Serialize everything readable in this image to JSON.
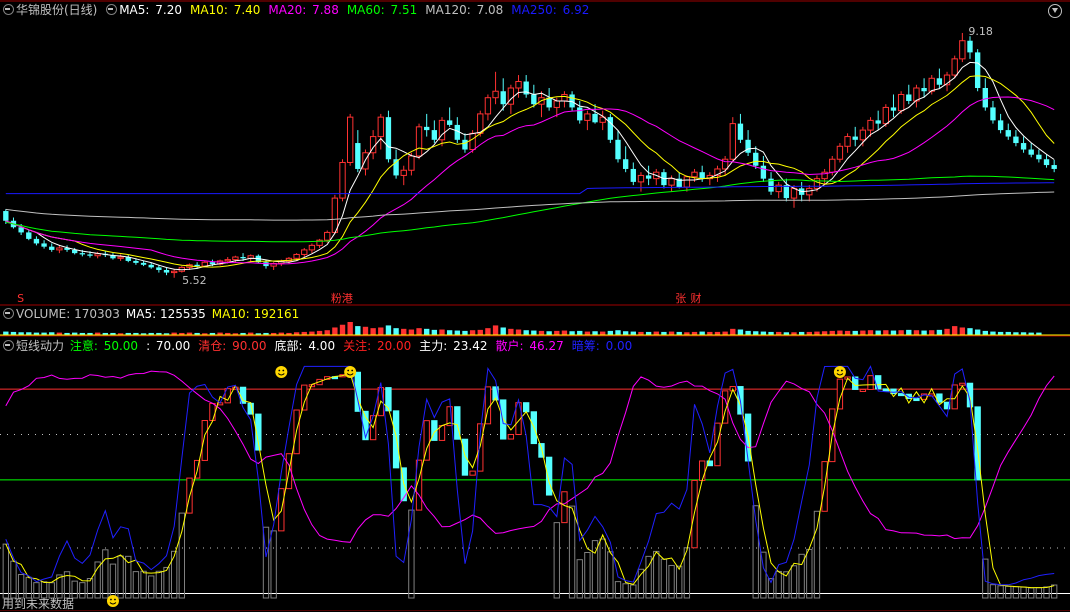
{
  "header": {
    "stock_name": "华锦股份(日线)",
    "ma": [
      {
        "label": "MA5: ",
        "value": "7.20",
        "color": "#ffffff"
      },
      {
        "label": "MA10: ",
        "value": "7.40",
        "color": "#ffff00"
      },
      {
        "label": "MA20: ",
        "value": "7.88",
        "color": "#ff00ff"
      },
      {
        "label": "MA60: ",
        "value": "7.51",
        "color": "#00ff00"
      },
      {
        "label": "MA120: ",
        "value": "7.08",
        "color": "#c0c0c0"
      },
      {
        "label": "MA250: ",
        "value": "6.92",
        "color": "#1a1aff"
      }
    ]
  },
  "volume_header": [
    {
      "text": "VOLUME: 170303",
      "color": "#c0c0c0"
    },
    {
      "text": "MA5: 125535",
      "color": "#ffffff"
    },
    {
      "text": "MA10: 192161",
      "color": "#ffff00"
    }
  ],
  "indicator_header": {
    "name": "短线动力",
    "items": [
      {
        "label": "注意: ",
        "value": "50.00",
        "color": "#00ff00"
      },
      {
        "label": ": ",
        "value": "70.00",
        "color": "#ffffff"
      },
      {
        "label": "清仓: ",
        "value": "90.00",
        "color": "#ff3030"
      },
      {
        "label": "底部: ",
        "value": "4.00",
        "color": "#ffffff"
      },
      {
        "label": "关注: ",
        "value": "20.00",
        "color": "#ff2020"
      },
      {
        "label": "主力: ",
        "value": "23.42",
        "color": "#ffffff"
      },
      {
        "label": "散户: ",
        "value": "46.27",
        "color": "#ff00ff"
      },
      {
        "label": "暗筹: ",
        "value": "0.00",
        "color": "#2020ff"
      }
    ]
  },
  "bottom_note": "用到未来数据",
  "chart_data": [
    {
      "type": "candlestick",
      "high_label": "9.18",
      "low_label": "5.52",
      "ylim": [
        5.3,
        9.5
      ],
      "markers": [
        {
          "text": "S",
          "index": 2,
          "color": "#ff3030"
        },
        {
          "text": "粉港",
          "index": 43,
          "color": "#ff3030"
        },
        {
          "text": "张",
          "index": 88,
          "color": "#ff3030"
        },
        {
          "text": "财",
          "index": 90,
          "color": "#ff3030"
        }
      ],
      "ohlc": [
        [
          6.55,
          6.58,
          6.35,
          6.4
        ],
        [
          6.4,
          6.45,
          6.28,
          6.3
        ],
        [
          6.3,
          6.35,
          6.18,
          6.22
        ],
        [
          6.22,
          6.25,
          6.1,
          6.12
        ],
        [
          6.12,
          6.16,
          6.02,
          6.05
        ],
        [
          6.05,
          6.1,
          5.97,
          6.0
        ],
        [
          6.0,
          6.05,
          5.92,
          5.95
        ],
        [
          5.95,
          6.02,
          5.9,
          5.98
        ],
        [
          5.98,
          6.02,
          5.92,
          5.95
        ],
        [
          5.95,
          5.98,
          5.88,
          5.9
        ],
        [
          5.9,
          5.95,
          5.85,
          5.88
        ],
        [
          5.88,
          5.93,
          5.83,
          5.86
        ],
        [
          5.86,
          5.92,
          5.82,
          5.89
        ],
        [
          5.89,
          5.93,
          5.84,
          5.87
        ],
        [
          5.87,
          5.9,
          5.8,
          5.82
        ],
        [
          5.82,
          5.88,
          5.78,
          5.84
        ],
        [
          5.84,
          5.87,
          5.76,
          5.78
        ],
        [
          5.78,
          5.82,
          5.72,
          5.75
        ],
        [
          5.75,
          5.78,
          5.7,
          5.72
        ],
        [
          5.72,
          5.75,
          5.66,
          5.68
        ],
        [
          5.68,
          5.72,
          5.6,
          5.64
        ],
        [
          5.64,
          5.68,
          5.56,
          5.6
        ],
        [
          5.6,
          5.66,
          5.52,
          5.62
        ],
        [
          5.62,
          5.7,
          5.6,
          5.68
        ],
        [
          5.68,
          5.74,
          5.64,
          5.72
        ],
        [
          5.72,
          5.76,
          5.66,
          5.7
        ],
        [
          5.7,
          5.78,
          5.68,
          5.76
        ],
        [
          5.76,
          5.8,
          5.7,
          5.73
        ],
        [
          5.73,
          5.8,
          5.71,
          5.78
        ],
        [
          5.78,
          5.84,
          5.74,
          5.8
        ],
        [
          5.8,
          5.86,
          5.76,
          5.84
        ],
        [
          5.84,
          5.9,
          5.78,
          5.82
        ],
        [
          5.82,
          5.88,
          5.76,
          5.86
        ],
        [
          5.86,
          5.88,
          5.74,
          5.76
        ],
        [
          5.76,
          5.8,
          5.66,
          5.7
        ],
        [
          5.7,
          5.76,
          5.64,
          5.74
        ],
        [
          5.74,
          5.8,
          5.7,
          5.78
        ],
        [
          5.78,
          5.84,
          5.74,
          5.82
        ],
        [
          5.82,
          5.9,
          5.78,
          5.88
        ],
        [
          5.88,
          5.98,
          5.84,
          5.95
        ],
        [
          5.95,
          6.05,
          5.9,
          6.02
        ],
        [
          6.02,
          6.12,
          5.98,
          6.1
        ],
        [
          6.1,
          6.25,
          6.06,
          6.22
        ],
        [
          6.22,
          6.8,
          6.2,
          6.75
        ],
        [
          6.75,
          7.35,
          6.7,
          7.3
        ],
        [
          7.3,
          8.05,
          7.25,
          8.0
        ],
        [
          7.6,
          7.8,
          7.15,
          7.2
        ],
        [
          7.2,
          7.5,
          7.1,
          7.45
        ],
        [
          7.45,
          7.8,
          7.35,
          7.7
        ],
        [
          7.7,
          8.05,
          7.5,
          8.0
        ],
        [
          8.0,
          8.1,
          7.3,
          7.35
        ],
        [
          7.35,
          7.5,
          7.05,
          7.1
        ],
        [
          7.1,
          7.25,
          6.95,
          7.18
        ],
        [
          7.18,
          7.45,
          7.1,
          7.4
        ],
        [
          7.4,
          7.9,
          7.35,
          7.85
        ],
        [
          7.85,
          8.05,
          7.7,
          7.8
        ],
        [
          7.8,
          7.95,
          7.6,
          7.65
        ],
        [
          7.65,
          8.0,
          7.55,
          7.95
        ],
        [
          7.95,
          8.15,
          7.85,
          7.88
        ],
        [
          7.88,
          8.0,
          7.6,
          7.65
        ],
        [
          7.65,
          7.75,
          7.45,
          7.5
        ],
        [
          7.5,
          7.8,
          7.45,
          7.75
        ],
        [
          7.75,
          8.1,
          7.7,
          8.05
        ],
        [
          8.05,
          8.35,
          7.95,
          8.3
        ],
        [
          8.3,
          8.7,
          8.2,
          8.4
        ],
        [
          8.4,
          8.6,
          8.1,
          8.2
        ],
        [
          8.2,
          8.5,
          8.05,
          8.45
        ],
        [
          8.45,
          8.65,
          8.3,
          8.55
        ],
        [
          8.55,
          8.65,
          8.3,
          8.35
        ],
        [
          8.35,
          8.5,
          8.15,
          8.2
        ],
        [
          8.2,
          8.4,
          8.0,
          8.3
        ],
        [
          8.3,
          8.45,
          8.1,
          8.15
        ],
        [
          8.15,
          8.3,
          8.0,
          8.25
        ],
        [
          8.25,
          8.4,
          8.15,
          8.35
        ],
        [
          8.35,
          8.4,
          8.1,
          8.15
        ],
        [
          8.15,
          8.25,
          7.9,
          7.95
        ],
        [
          7.95,
          8.1,
          7.8,
          8.05
        ],
        [
          8.05,
          8.2,
          7.9,
          7.92
        ],
        [
          7.92,
          8.1,
          7.8,
          8.0
        ],
        [
          8.0,
          8.05,
          7.6,
          7.65
        ],
        [
          7.65,
          7.8,
          7.3,
          7.35
        ],
        [
          7.35,
          7.55,
          7.15,
          7.2
        ],
        [
          7.2,
          7.3,
          6.95,
          7.0
        ],
        [
          7.0,
          7.15,
          6.85,
          7.1
        ],
        [
          7.1,
          7.25,
          6.95,
          7.05
        ],
        [
          7.05,
          7.2,
          6.95,
          7.15
        ],
        [
          7.15,
          7.2,
          6.9,
          6.95
        ],
        [
          6.95,
          7.1,
          6.85,
          7.05
        ],
        [
          7.05,
          7.15,
          6.9,
          6.92
        ],
        [
          6.92,
          7.1,
          6.85,
          7.08
        ],
        [
          7.08,
          7.2,
          7.0,
          7.15
        ],
        [
          7.15,
          7.25,
          7.0,
          7.05
        ],
        [
          7.05,
          7.15,
          6.95,
          7.1
        ],
        [
          7.1,
          7.25,
          7.0,
          7.2
        ],
        [
          7.2,
          7.4,
          7.1,
          7.35
        ],
        [
          7.35,
          8.0,
          7.3,
          7.9
        ],
        [
          7.9,
          8.05,
          7.6,
          7.65
        ],
        [
          7.65,
          7.8,
          7.4,
          7.45
        ],
        [
          7.45,
          7.55,
          7.2,
          7.25
        ],
        [
          7.25,
          7.4,
          7.0,
          7.05
        ],
        [
          7.05,
          7.15,
          6.8,
          6.85
        ],
        [
          6.85,
          7.0,
          6.75,
          6.95
        ],
        [
          6.95,
          7.05,
          6.7,
          6.75
        ],
        [
          6.75,
          6.95,
          6.6,
          6.9
        ],
        [
          6.9,
          7.0,
          6.7,
          6.8
        ],
        [
          6.8,
          6.95,
          6.7,
          6.9
        ],
        [
          6.9,
          7.1,
          6.85,
          7.05
        ],
        [
          7.05,
          7.2,
          6.95,
          7.15
        ],
        [
          7.15,
          7.4,
          7.1,
          7.35
        ],
        [
          7.35,
          7.6,
          7.3,
          7.55
        ],
        [
          7.55,
          7.75,
          7.45,
          7.7
        ],
        [
          7.7,
          7.85,
          7.55,
          7.65
        ],
        [
          7.65,
          7.85,
          7.55,
          7.8
        ],
        [
          7.8,
          8.0,
          7.7,
          7.95
        ],
        [
          7.95,
          8.1,
          7.8,
          7.9
        ],
        [
          7.9,
          8.2,
          7.85,
          8.15
        ],
        [
          8.15,
          8.35,
          8.0,
          8.1
        ],
        [
          8.1,
          8.4,
          8.05,
          8.35
        ],
        [
          8.35,
          8.5,
          8.2,
          8.25
        ],
        [
          8.25,
          8.5,
          8.15,
          8.45
        ],
        [
          8.45,
          8.6,
          8.3,
          8.4
        ],
        [
          8.4,
          8.65,
          8.35,
          8.6
        ],
        [
          8.6,
          8.75,
          8.45,
          8.5
        ],
        [
          8.5,
          8.7,
          8.4,
          8.65
        ],
        [
          8.65,
          8.95,
          8.6,
          8.9
        ],
        [
          8.9,
          9.3,
          8.85,
          9.18
        ],
        [
          9.18,
          9.25,
          8.9,
          9.0
        ],
        [
          9.0,
          9.05,
          8.4,
          8.45
        ],
        [
          8.45,
          8.6,
          8.1,
          8.15
        ],
        [
          8.15,
          8.25,
          7.9,
          7.95
        ],
        [
          7.95,
          8.05,
          7.75,
          7.8
        ],
        [
          7.8,
          7.9,
          7.65,
          7.7
        ],
        [
          7.7,
          7.8,
          7.55,
          7.6
        ],
        [
          7.6,
          7.7,
          7.45,
          7.5
        ],
        [
          7.5,
          7.6,
          7.38,
          7.42
        ],
        [
          7.42,
          7.5,
          7.3,
          7.35
        ],
        [
          7.35,
          7.42,
          7.22,
          7.26
        ],
        [
          7.26,
          7.34,
          7.15,
          7.2
        ]
      ],
      "volumes": [
        10,
        9,
        8,
        8,
        7,
        7,
        8,
        7,
        6,
        7,
        6,
        6,
        7,
        6,
        6,
        5,
        6,
        6,
        5,
        6,
        6,
        5,
        7,
        6,
        7,
        6,
        5,
        6,
        7,
        6,
        5,
        6,
        7,
        5,
        6,
        6,
        7,
        6,
        8,
        9,
        10,
        12,
        14,
        22,
        30,
        38,
        26,
        24,
        20,
        22,
        28,
        20,
        18,
        16,
        20,
        18,
        15,
        16,
        14,
        13,
        12,
        14,
        15,
        20,
        28,
        22,
        18,
        16,
        14,
        13,
        12,
        11,
        12,
        13,
        11,
        12,
        10,
        11,
        10,
        12,
        14,
        11,
        10,
        9,
        9,
        10,
        9,
        10,
        9,
        8,
        9,
        10,
        9,
        9,
        10,
        18,
        16,
        12,
        11,
        10,
        9,
        9,
        8,
        8,
        9,
        9,
        10,
        11,
        12,
        13,
        12,
        12,
        13,
        14,
        13,
        14,
        13,
        14,
        15,
        14,
        13,
        14,
        15,
        18,
        26,
        22,
        20,
        16,
        12,
        10,
        9,
        9,
        8,
        8,
        7,
        7
      ]
    },
    {
      "type": "indicator",
      "ylim": [
        -2,
        105
      ],
      "levels": [
        {
          "value": 90,
          "color": "#ff3030",
          "style": "solid"
        },
        {
          "value": 70,
          "color": "#c0c0c0",
          "style": "dotted"
        },
        {
          "value": 50,
          "color": "#00ff00",
          "style": "solid"
        },
        {
          "value": 20,
          "color": "#c0c0c0",
          "style": "dotted"
        },
        {
          "value": 0,
          "color": "#ffffff",
          "style": "solid"
        }
      ],
      "smiley_positions": [
        36,
        45,
        109
      ],
      "bottom_smiley_position": 14
    }
  ]
}
